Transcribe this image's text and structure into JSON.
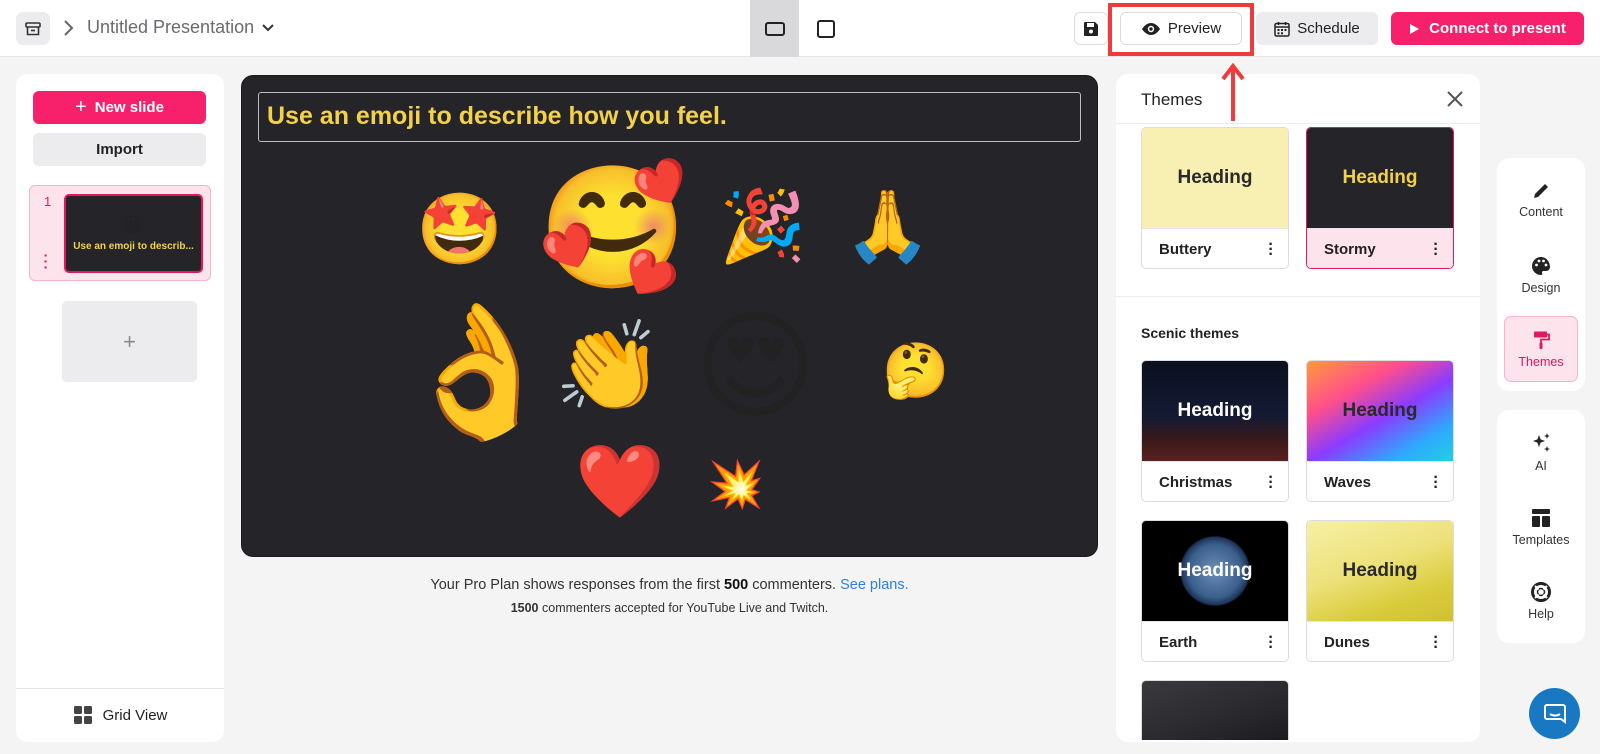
{
  "header": {
    "title": "Untitled Presentation",
    "preview_label": "Preview",
    "schedule_label": "Schedule",
    "connect_label": "Connect to present"
  },
  "left_panel": {
    "new_slide_label": "New slide",
    "import_label": "Import",
    "slides": [
      {
        "number": "1",
        "emoji": "😀",
        "text": "Use an emoji to describ..."
      }
    ],
    "add_symbol": "+",
    "grid_view_label": "Grid View"
  },
  "slide": {
    "title": "Use an emoji to describe how you feel.",
    "emojis": [
      "🤩",
      "🥰",
      "🎉",
      "🙏",
      "👌",
      "👏",
      "😍",
      "🤔",
      "❤️",
      "💥"
    ]
  },
  "footer": {
    "prefix": "Your Pro Plan shows responses from the first ",
    "count": "500",
    "suffix": " commenters. ",
    "link": "See plans.",
    "sub_count": "1500",
    "sub_text": " commenters accepted for YouTube Live and Twitch."
  },
  "themes": {
    "title": "Themes",
    "heading_text": "Heading",
    "basic": [
      {
        "name": "Buttery",
        "bg": "#f7f0b2",
        "fg": "#2a2a2a",
        "selected": false
      },
      {
        "name": "Stormy",
        "bg": "#252529",
        "fg": "#f3d24a",
        "selected": true
      }
    ],
    "scenic_title": "Scenic themes",
    "scenic": [
      {
        "name": "Christmas"
      },
      {
        "name": "Waves"
      },
      {
        "name": "Earth"
      },
      {
        "name": "Dunes"
      }
    ]
  },
  "tools": {
    "content": "Content",
    "design": "Design",
    "themes": "Themes",
    "ai": "AI",
    "templates": "Templates",
    "help": "Help"
  },
  "colors": {
    "accent": "#f7206a",
    "highlight": "#ef3b3b",
    "slide_bg": "#252529",
    "slide_text": "#f3d24a",
    "link": "#2f7fe0"
  }
}
